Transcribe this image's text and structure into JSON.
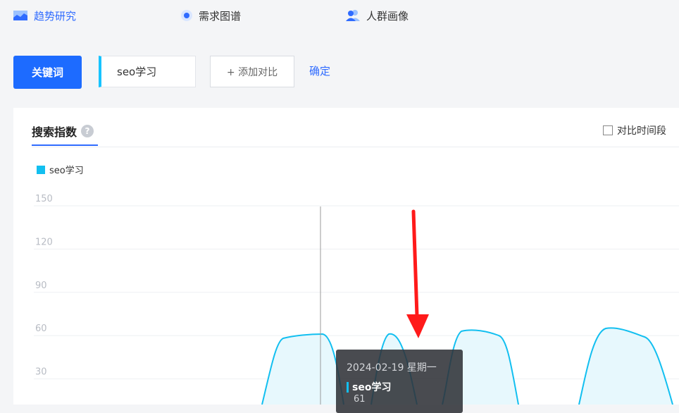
{
  "nav": {
    "items": [
      {
        "label": "趋势研究",
        "icon": "chart-area-icon",
        "active": true
      },
      {
        "label": "需求图谱",
        "icon": "radio-dot-icon",
        "active": false
      },
      {
        "label": "人群画像",
        "icon": "people-icon",
        "active": false
      }
    ]
  },
  "keyword_bar": {
    "button_label": "关键词",
    "keyword": "seo学习",
    "add_compare_label": "+ 添加对比",
    "confirm_label": "确定"
  },
  "panel": {
    "tab_label": "搜索指数",
    "compare_time_label": "对比时间段",
    "colors": {
      "accent": "#2f6bff",
      "series": "#12bff0",
      "annotation_arrow": "#ff1a1a"
    }
  },
  "chart_data": {
    "type": "area",
    "series": [
      {
        "name": "seo学习",
        "color": "#12bff0"
      }
    ],
    "y_ticks": [
      30,
      60,
      90,
      120,
      150
    ],
    "ylim": [
      0,
      150
    ],
    "grid": true,
    "legend": "top-left"
  },
  "tooltip": {
    "date": "2024-02-19 星期一",
    "series_name": "seo学习",
    "value": "61"
  }
}
